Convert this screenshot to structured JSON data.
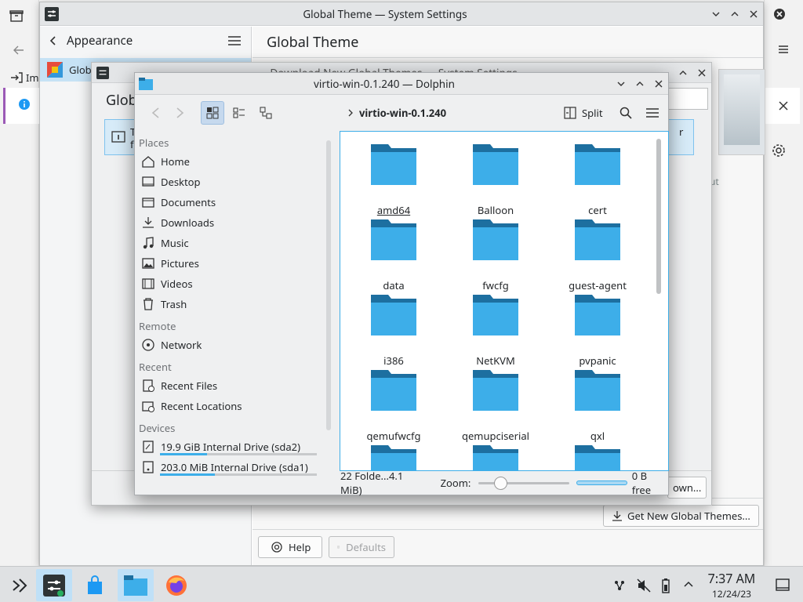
{
  "settings": {
    "window_title": "Global Theme — System Settings",
    "sidebar_title": "Appearance",
    "sidebar_selected": "Glob",
    "main_title": "Global Theme",
    "help_label": "Help",
    "defaults_label": "Defaults",
    "get_new_label": "Get New Global Themes...",
    "download_partial": "own...",
    "bg_text_ut": "ut"
  },
  "background": {
    "tab_label_partial": "Im"
  },
  "download_dialog": {
    "title": "Download New Global Themes — System Settings",
    "heading": "Glob",
    "info_t": "T",
    "info_f": "f",
    "info_r": "r"
  },
  "dolphin": {
    "title": "virtio-win-0.1.240 — Dolphin",
    "breadcrumb": "virtio-win-0.1.240",
    "split_label": "Split",
    "places_header": "Places",
    "places": [
      "Home",
      "Desktop",
      "Documents",
      "Downloads",
      "Music",
      "Pictures",
      "Videos",
      "Trash"
    ],
    "remote_header": "Remote",
    "remote": [
      "Network"
    ],
    "recent_header": "Recent",
    "recent": [
      "Recent Files",
      "Recent Locations"
    ],
    "devices_header": "Devices",
    "devices": [
      {
        "label": "19.9 GiB Internal Drive (sda2)",
        "usage": 0.3
      },
      {
        "label": "203.0 MiB Internal Drive (sda1)",
        "usage": 0.35
      }
    ],
    "folders": [
      "amd64",
      "Balloon",
      "cert",
      "data",
      "fwcfg",
      "guest-agent",
      "i386",
      "NetKVM",
      "pvpanic",
      "qemufwcfg",
      "qemupciserial",
      "qxl"
    ],
    "status_summary": "22 Folde...4.1 MiB)",
    "zoom_label": "Zoom:",
    "zoom_level": 0.2,
    "free_space": "0 B free"
  },
  "taskbar": {
    "time": "7:37 AM",
    "date": "12/24/23"
  },
  "colors": {
    "accent": "#3daee9",
    "folder_body": "#3daee9",
    "folder_tab": "#1d6fa0"
  }
}
